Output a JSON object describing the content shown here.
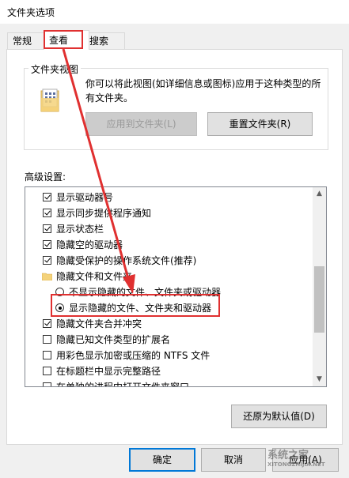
{
  "window": {
    "title": "文件夹选项"
  },
  "tabs": [
    {
      "label": "常规"
    },
    {
      "label": "查看"
    },
    {
      "label": "搜索"
    }
  ],
  "folder_views": {
    "group_label": "文件夹视图",
    "description": "你可以将此视图(如详细信息或图标)应用于这种类型的所有文件夹。",
    "apply_button": "应用到文件夹(L)",
    "reset_button": "重置文件夹(R)"
  },
  "advanced": {
    "label": "高级设置:",
    "items": [
      {
        "type": "checkbox",
        "checked": true,
        "label": "显示驱动器号"
      },
      {
        "type": "checkbox",
        "checked": true,
        "label": "显示同步提供程序通知"
      },
      {
        "type": "checkbox",
        "checked": true,
        "label": "显示状态栏"
      },
      {
        "type": "checkbox",
        "checked": true,
        "label": "隐藏空的驱动器"
      },
      {
        "type": "checkbox",
        "checked": true,
        "label": "隐藏受保护的操作系统文件(推荐)"
      },
      {
        "type": "folder",
        "label": "隐藏文件和文件夹"
      },
      {
        "type": "radio",
        "selected": false,
        "label": "不显示隐藏的文件、文件夹或驱动器"
      },
      {
        "type": "radio",
        "selected": true,
        "label": "显示隐藏的文件、文件夹和驱动器"
      },
      {
        "type": "checkbox",
        "checked": true,
        "label": "隐藏文件夹合并冲突"
      },
      {
        "type": "checkbox",
        "checked": false,
        "label": "隐藏已知文件类型的扩展名"
      },
      {
        "type": "checkbox",
        "checked": false,
        "label": "用彩色显示加密或压缩的 NTFS 文件"
      },
      {
        "type": "checkbox",
        "checked": false,
        "label": "在标题栏中显示完整路径"
      },
      {
        "type": "checkbox",
        "checked": false,
        "label": "在单独的进程中打开文件夹窗口"
      }
    ],
    "restore_button": "还原为默认值(D)"
  },
  "footer": {
    "ok_button": "确定",
    "cancel_button": "取消",
    "apply_button": "应用(A)"
  },
  "watermark": {
    "text": "系统之家",
    "url": "XITONGZHIJIA.NET"
  },
  "colors": {
    "highlight": "#e03030",
    "focus": "#0078d7",
    "folder": "#f4d27a"
  }
}
